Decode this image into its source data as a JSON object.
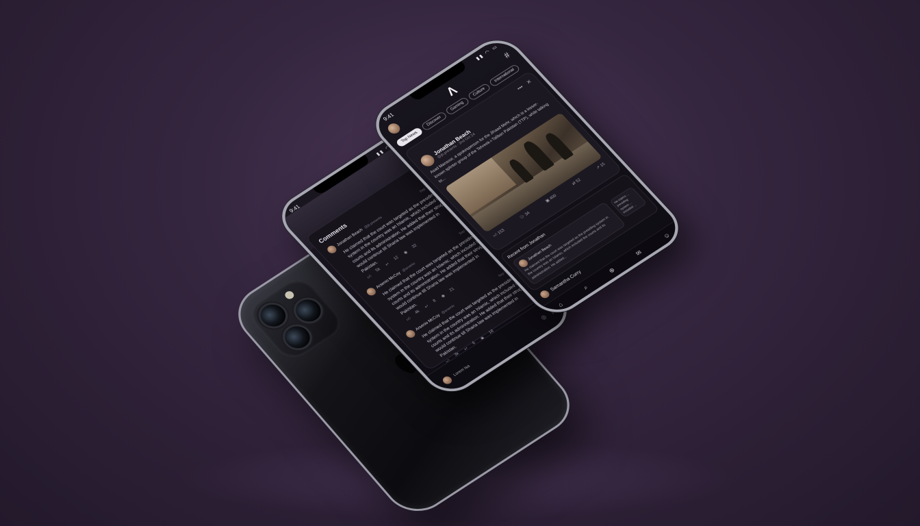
{
  "back_phone": {
    "logo": ""
  },
  "comments_screen": {
    "status_time": "9:41",
    "status_icons": "▮▮ ◠ ▭",
    "title": "Comments",
    "close": "✕",
    "comments": [
      {
        "author": "Jonathan Beach",
        "meta": "@jb.presents",
        "date": "Sep 7th 24",
        "text": "He claimed that the court was targeted as the presiding system in the country was an Islamic, which included the courts and its administration. He added that their struggle would continue till Sharia law was implemented in Pakistan.",
        "likes": "5k",
        "replies": "12",
        "views": "32"
      },
      {
        "author": "Arsenio McCoy",
        "meta": "@arsenio",
        "date": "Sep 8th 24",
        "text": "He claimed that the court was targeted as the presiding system in the country was an Islamic, which included the courts and its administration. He added that their struggle would continue till Sharia law was implemented in Pakistan.",
        "likes": "4k",
        "replies": "8",
        "views": "21"
      },
      {
        "author": "Arsenio McCoy",
        "meta": "@arsenio",
        "date": "Sep 8th 24",
        "text": "He claimed that the court was targeted as the presiding system in the country was an Islamic, which included the courts and its administration. He added that their struggle would continue till Sharia law was implemented in Pakistan.",
        "likes": "3k",
        "replies": "6",
        "views": "18"
      }
    ],
    "bottom_name": "Lorem Isa",
    "bottom_icons": "◎ ▷"
  },
  "feed_screen": {
    "status_time": "9:41",
    "status_icons": "▮▮ ◠ ▭",
    "logo": "Λ",
    "hash_icon": "#",
    "tabs": [
      "Top News",
      "Discover",
      "Gaming",
      "Culture",
      "International"
    ],
    "post": {
      "more": "•••",
      "close": "✕",
      "author": "Jonathan Beach",
      "meta": "@jb.presents · 2nd Oct 24",
      "text": "Asad Mansoor, a spokesperson for the Jihaad Mehr, which is a lesser-known splinter group of the Tehreek-i-Taliban Pakistan (TTP), while talking to...",
      "stats": {
        "likes": "153",
        "comments": "34",
        "saves": "400",
        "reposts": "52",
        "shares": "15"
      }
    },
    "recent": {
      "title": "Recent from Jonathan",
      "card_author": "Jonathan Beach",
      "card_text": "He claimed that the court was targeted as the presiding system in the country was an Islamic, which included the courts and its administration. He added...",
      "side_text": "He claims ... presiding system ... included ..."
    },
    "user_bar_name": "Samantha Curry",
    "nav_icons": [
      "⌂",
      "⌕",
      "⊕",
      "✉",
      "☺"
    ]
  }
}
